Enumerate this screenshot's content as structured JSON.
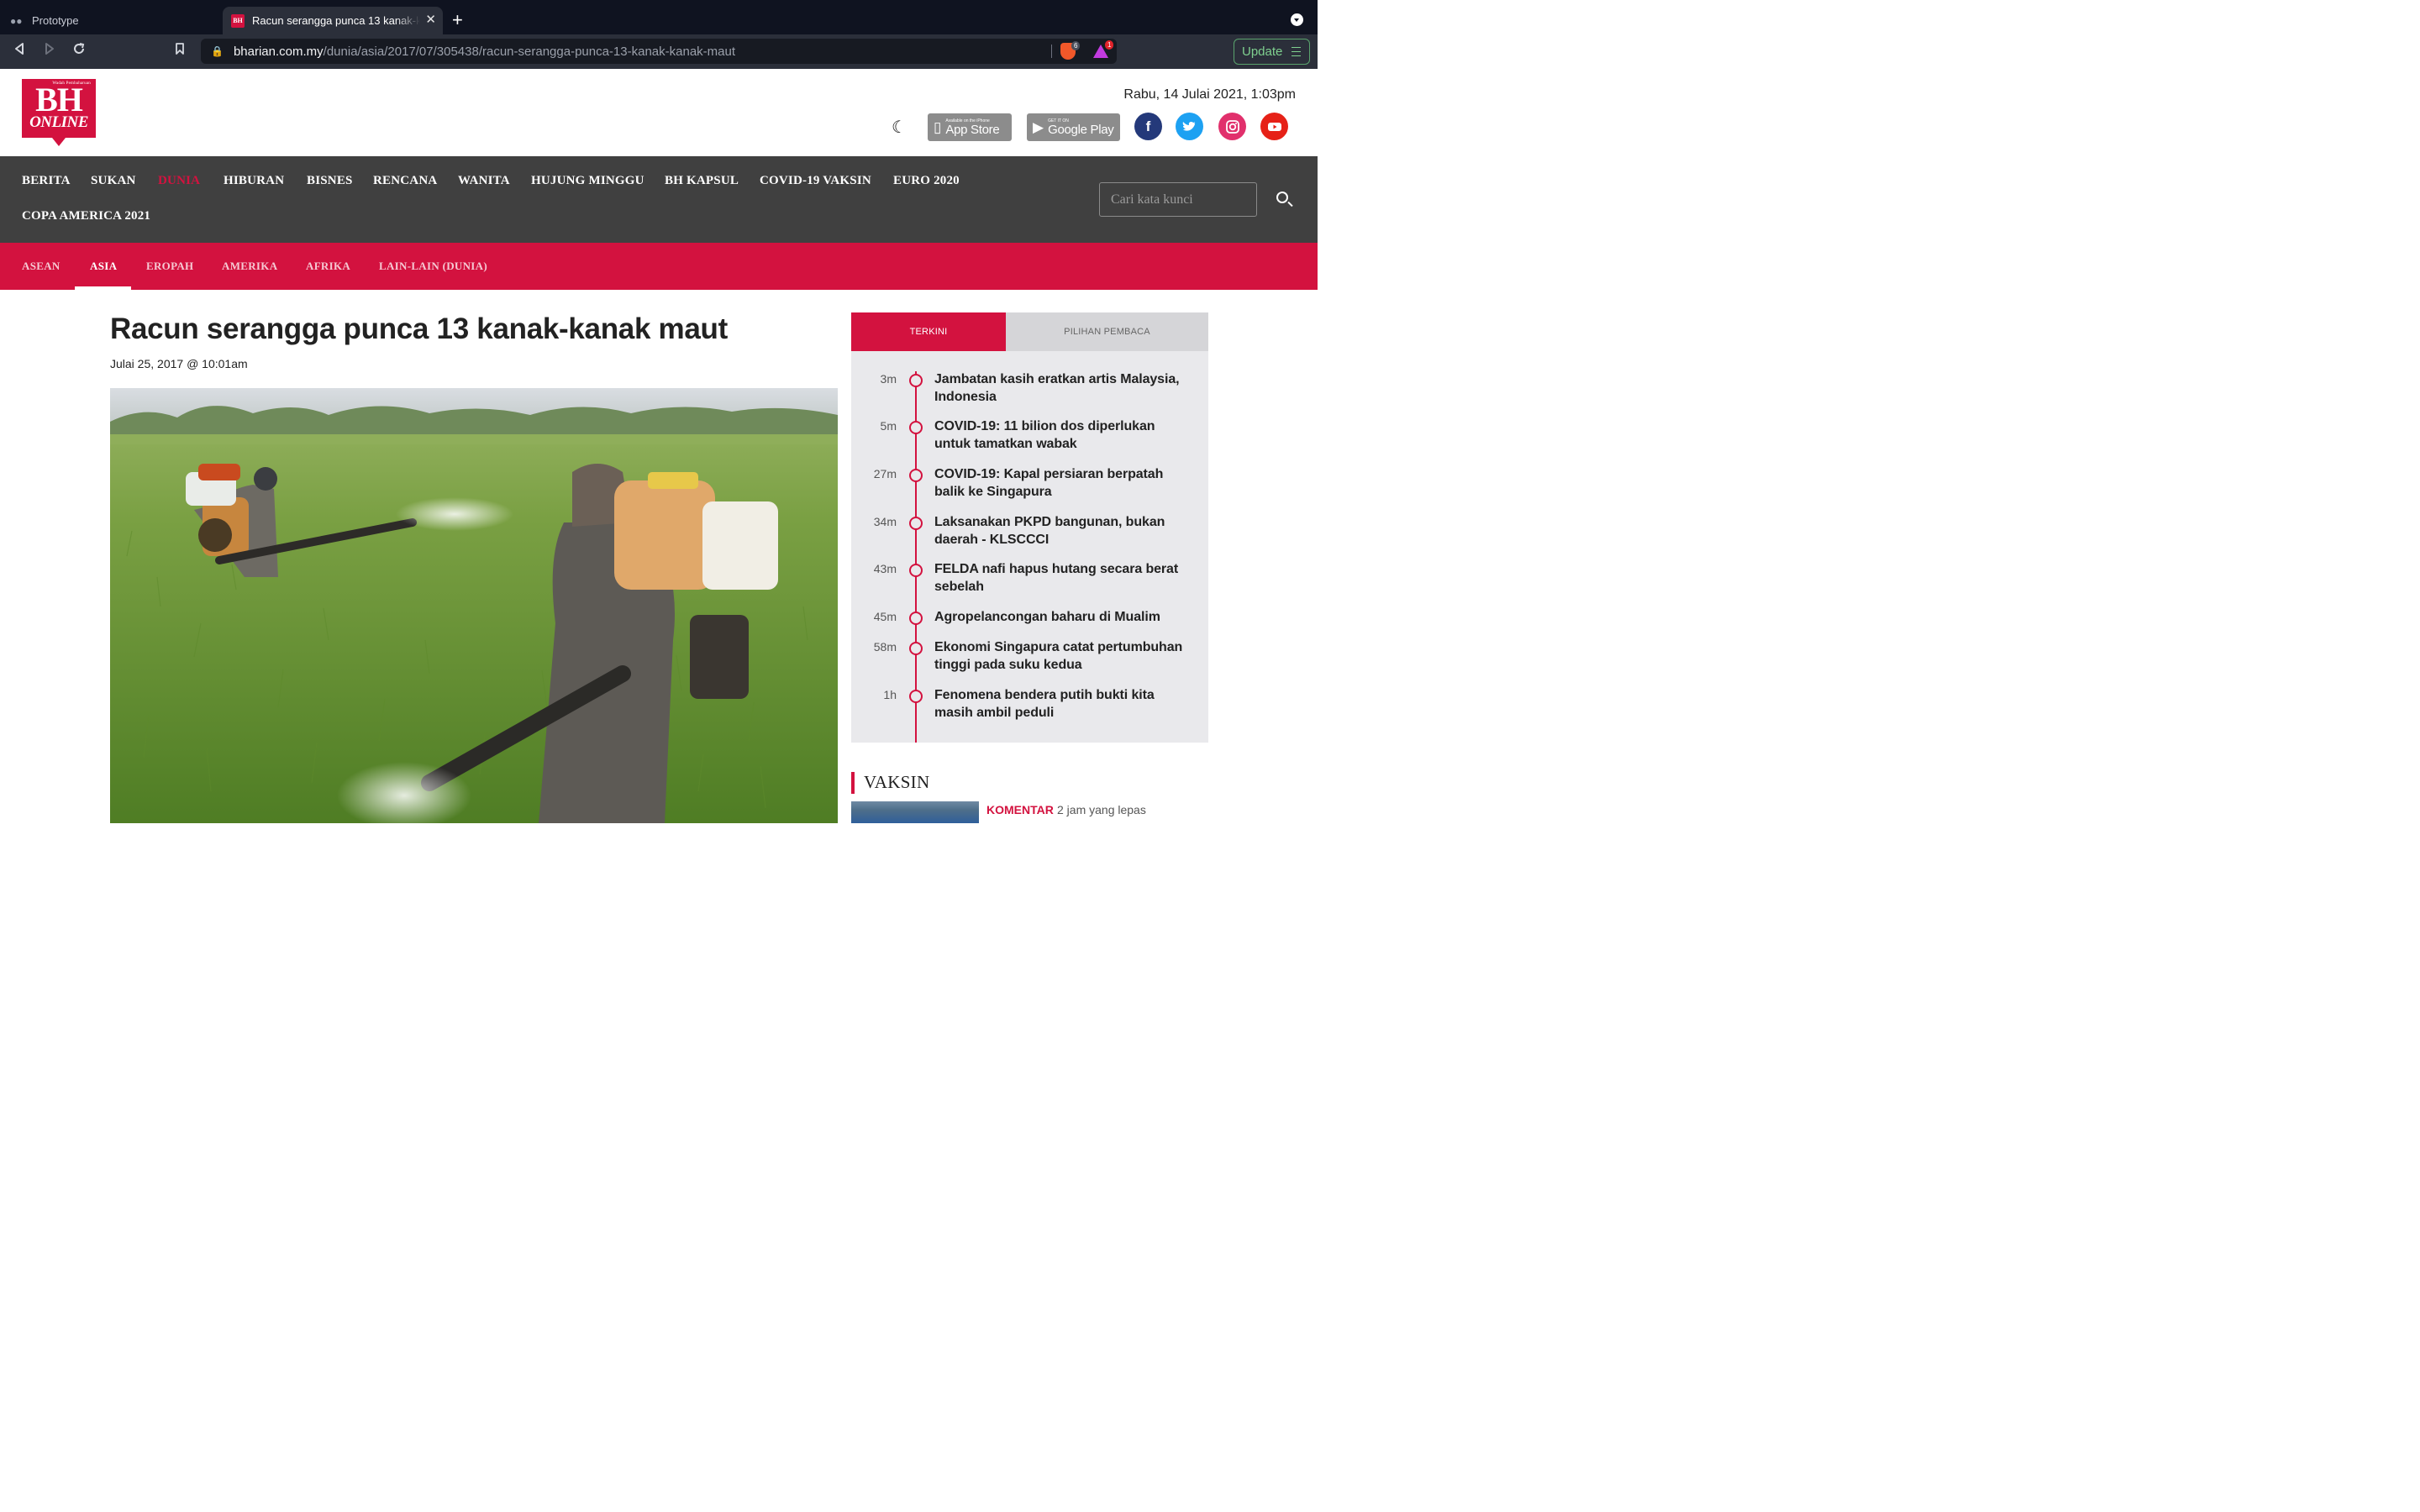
{
  "browser": {
    "inactive_tab": "Prototype",
    "active_tab": "Racun serangga punca 13 kanak-kanak maut",
    "favicon_text": "BH",
    "url_host": "bharian.com.my",
    "url_path": "/dunia/asia/2017/07/305438/racun-serangga-punca-13-kanak-kanak-maut",
    "brave_badge": "6",
    "rewards_badge": "1",
    "update_label": "Update"
  },
  "header": {
    "logo_tagline": "Wadah Pembaharuan",
    "logo_bh": "BH",
    "logo_online": "ONLINE",
    "date": "Rabu, 14 Julai 2021, 1:03pm",
    "appstore_small": "Available on the iPhone",
    "appstore_big": "App Store",
    "gplay_small": "GET IT ON",
    "gplay_big": "Google Play",
    "brand_color": "#d3123f"
  },
  "nav": {
    "items": [
      "BERITA",
      "SUKAN",
      "DUNIA",
      "HIBURAN",
      "BISNES",
      "RENCANA",
      "WANITA",
      "HUJUNG MINGGU",
      "BH KAPSUL",
      "COVID-19 VAKSIN",
      "EURO 2020",
      "COPA AMERICA 2021"
    ],
    "active": "DUNIA",
    "search_placeholder": "Cari kata kunci"
  },
  "subnav": {
    "items": [
      "ASEAN",
      "ASIA",
      "EROPAH",
      "AMERIKA",
      "AFRIKA",
      "LAIN-LAIN (DUNIA)"
    ],
    "active": "ASIA"
  },
  "article": {
    "title": "Racun serangga punca 13 kanak-kanak maut",
    "date": "Julai 25, 2017 @ 10:01am"
  },
  "sidebar": {
    "tab_terkini": "TERKINI",
    "tab_pilihan": "PILIHAN PEMBACA",
    "news": [
      {
        "age": "3m",
        "headline": "Jambatan kasih eratkan artis Malaysia, Indonesia"
      },
      {
        "age": "5m",
        "headline": "COVID-19: 11 bilion dos diperlukan untuk tamatkan wabak"
      },
      {
        "age": "27m",
        "headline": "COVID-19: Kapal persiaran berpatah balik ke Singapura"
      },
      {
        "age": "34m",
        "headline": "Laksanakan PKPD bangunan, bukan daerah - KLSCCCI"
      },
      {
        "age": "43m",
        "headline": "FELDA nafi hapus hutang secara berat sebelah"
      },
      {
        "age": "45m",
        "headline": "Agropelancongan baharu di Mualim"
      },
      {
        "age": "58m",
        "headline": "Ekonomi Singapura catat pertumbuhan tinggi pada suku kedua"
      },
      {
        "age": "1h",
        "headline": "Fenomena bendera putih bukti kita masih ambil peduli"
      }
    ],
    "vaksin_title": "VAKSIN",
    "komentar_label": "KOMENTAR",
    "komentar_time": "2 jam yang lepas"
  }
}
